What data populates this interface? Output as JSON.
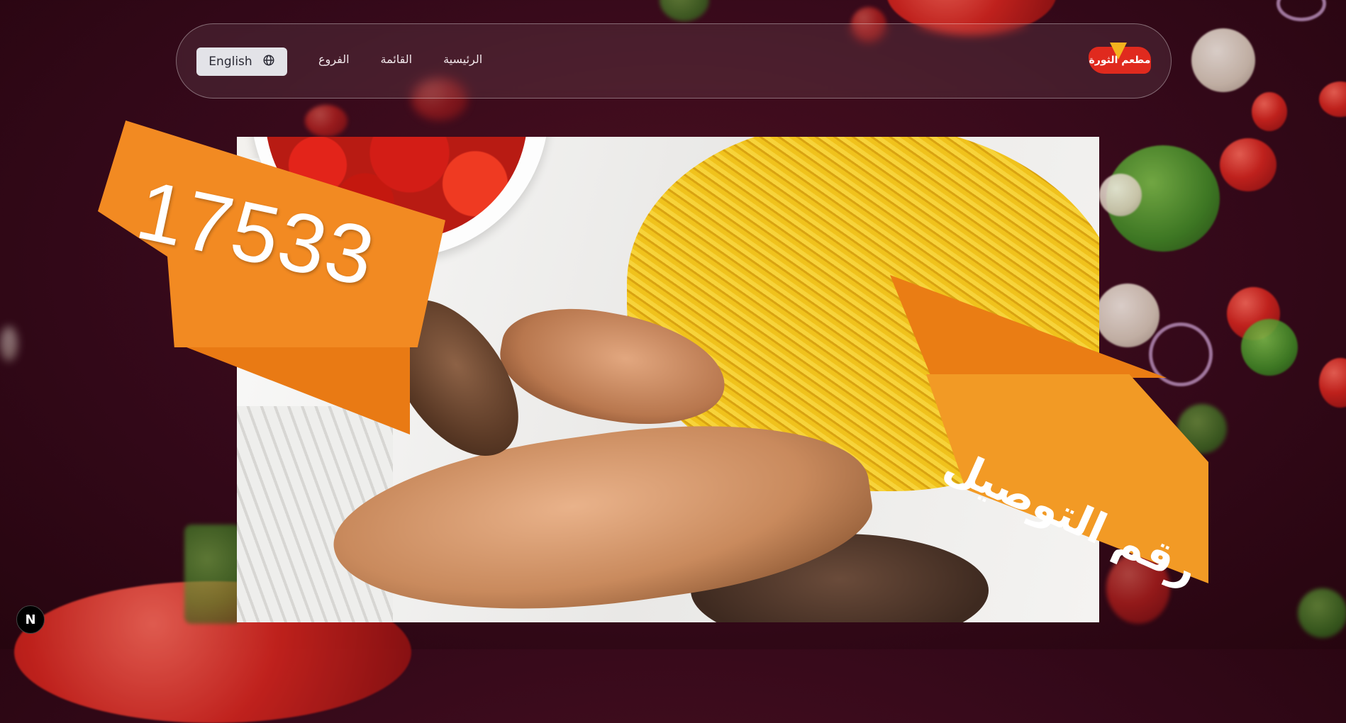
{
  "nav": {
    "language_button": "English",
    "links": [
      "الرئيسية",
      "القائمة",
      "الفروع"
    ],
    "logo_text": "مطعم الثورة"
  },
  "hero": {
    "phone_number": "17533",
    "delivery_label": "رقم التوصيل"
  },
  "badge": {
    "letter": "N"
  },
  "colors": {
    "background": "#35091a",
    "banner_orange": "#f28a22",
    "logo_red": "#e02a1e"
  },
  "icons": {
    "language": "globe-icon",
    "badge": "next-logo-icon"
  }
}
